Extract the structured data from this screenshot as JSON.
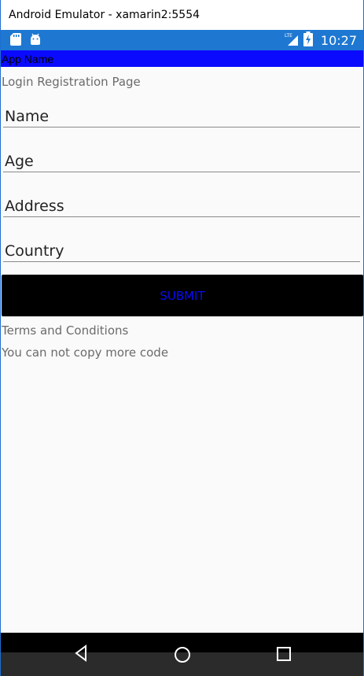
{
  "window": {
    "title": "Android Emulator - xamarin2:5554"
  },
  "statusbar": {
    "left_icons": [
      "sd-card-icon",
      "android-icon"
    ],
    "network_label": "LTE",
    "time": "10:27",
    "background_color": "#1e78d2"
  },
  "appbar": {
    "title": "App Name",
    "background_color": "#0a0aff"
  },
  "page": {
    "heading": "Login Registration Page"
  },
  "form": {
    "fields": [
      {
        "placeholder": "Name",
        "value": ""
      },
      {
        "placeholder": "Age",
        "value": ""
      },
      {
        "placeholder": "Address",
        "value": ""
      },
      {
        "placeholder": "Country",
        "value": ""
      }
    ],
    "submit_label": "SUBMIT",
    "submit_text_color": "#0a0aff",
    "submit_background": "#000000"
  },
  "footer": {
    "terms": "Terms and Conditions",
    "note": "You can not copy more code"
  },
  "navbar": {
    "buttons": [
      "back-icon",
      "home-icon",
      "recents-icon"
    ]
  }
}
